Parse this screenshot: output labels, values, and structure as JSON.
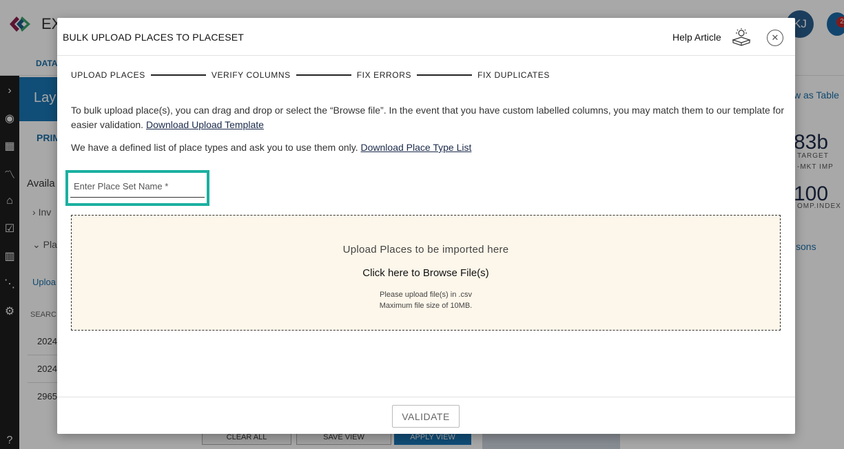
{
  "background": {
    "app_title": "EX",
    "data_tab": "DATA",
    "avatar_initials": "KJ",
    "notification_count": "2",
    "layers_title": "Lay",
    "primary_tab": "PRIM",
    "available_label": "Availa",
    "tree_items": [
      "Inv",
      "Pla"
    ],
    "upload_link": "Uploa",
    "search_label": "SEARC",
    "list_values": [
      "2024",
      "2024",
      "2965"
    ],
    "view_table_link": "w as Table",
    "metric1_value": "83b",
    "metric1_sub1": "TARGET",
    "metric1_sub2": "-MKT IMP",
    "metric2_value": "100",
    "metric2_sub": "OMP.INDEX",
    "comparisons_link": "sons",
    "bottom_buttons": [
      "CLEAR ALL",
      "SAVE VIEW",
      "APPLY VIEW"
    ]
  },
  "modal": {
    "title": "BULK UPLOAD PLACES TO PLACESET",
    "help_label": "Help Article",
    "help_icon": "help-article-icon",
    "close_icon": "close-icon",
    "steps": [
      "UPLOAD PLACES",
      "VERIFY COLUMNS",
      "FIX ERRORS",
      "FIX DUPLICATES"
    ],
    "description_text": "To bulk upload place(s), you can drag and drop or select the “Browse file”. In the event that you have custom labelled columns, you may match them to our template for easier validation.",
    "download_template_link": "Download Upload Template",
    "place_types_text": "We have a defined list of place types and ask you to use them only.",
    "download_place_types_link": "Download Place Type List",
    "place_set_name": {
      "value": "",
      "placeholder": "Enter Place Set Name *"
    },
    "highlight_color": "#1bb0a0",
    "dropzone": {
      "title": "Upload Places to be imported here",
      "browse_label": "Click here to Browse File(s)",
      "hint_format": "Please upload file(s) in .csv",
      "hint_size": "Maximum file size of 10MB."
    },
    "validate_label": "VALIDATE"
  }
}
